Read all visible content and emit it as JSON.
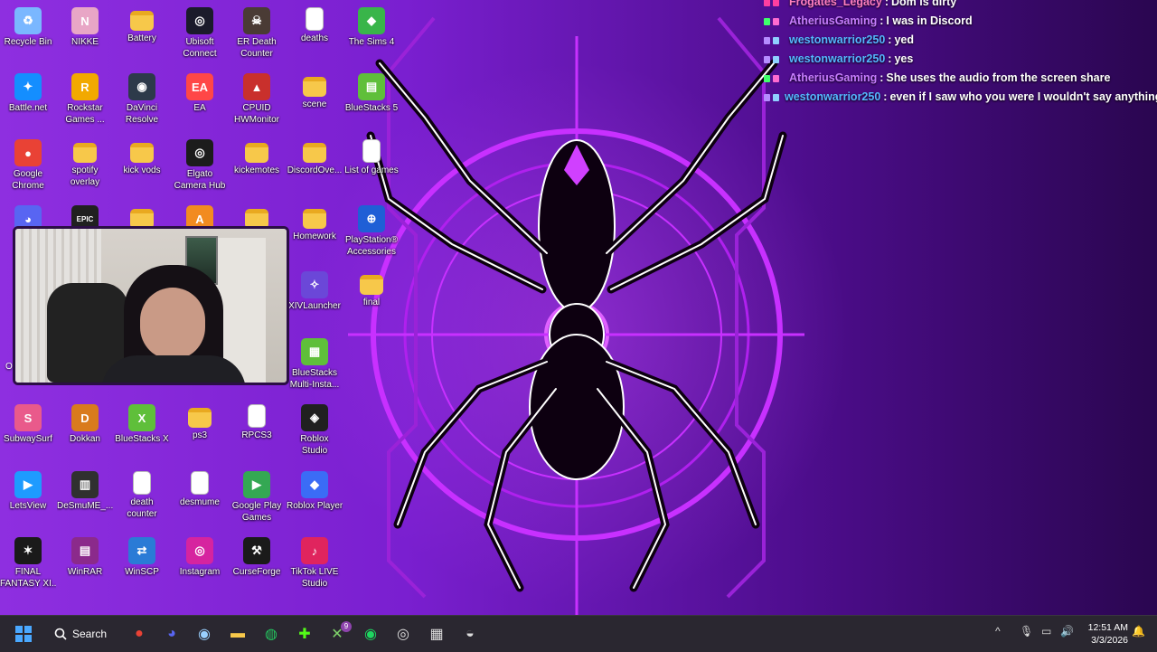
{
  "desktop": {
    "icons": [
      {
        "label": "Recycle Bin",
        "label2": "",
        "icon": "recycle-bin-icon",
        "glyph": "♻",
        "color": "#7ab7ff",
        "type": "app"
      },
      {
        "label": "NIKKE",
        "label2": "",
        "icon": "nikke-icon",
        "glyph": "N",
        "color": "#e8a6c6",
        "type": "app"
      },
      {
        "label": "Battery",
        "label2": "",
        "icon": "folder-icon",
        "glyph": "",
        "color": "#f7c84a",
        "type": "folder"
      },
      {
        "label": "Ubisoft",
        "label2": "Connect",
        "icon": "ubisoft-icon",
        "glyph": "◎",
        "color": "#1b1b2b",
        "type": "app"
      },
      {
        "label": "ER Death",
        "label2": "Counter",
        "icon": "er-death-counter-icon",
        "glyph": "☠",
        "color": "#4a3b35",
        "type": "app"
      },
      {
        "label": "deaths",
        "label2": "",
        "icon": "document-icon",
        "glyph": "",
        "color": "#ffffff",
        "type": "doc"
      },
      {
        "label": "The Sims 4",
        "label2": "",
        "icon": "sims-icon",
        "glyph": "◆",
        "color": "#39b54a",
        "type": "app"
      },
      {
        "label": "Battle.net",
        "label2": "",
        "icon": "battlenet-icon",
        "glyph": "✦",
        "color": "#148eff",
        "type": "app"
      },
      {
        "label": "Rockstar",
        "label2": "Games ...",
        "icon": "rockstar-icon",
        "glyph": "R",
        "color": "#f2a900",
        "type": "app"
      },
      {
        "label": "DaVinci",
        "label2": "Resolve",
        "icon": "davinci-icon",
        "glyph": "◉",
        "color": "#2d3a4a",
        "type": "app"
      },
      {
        "label": "EA",
        "label2": "",
        "icon": "ea-icon",
        "glyph": "EA",
        "color": "#ff4747",
        "type": "app"
      },
      {
        "label": "CPUID",
        "label2": "HWMonitor",
        "icon": "cpuid-icon",
        "glyph": "▲",
        "color": "#c9302c",
        "type": "app"
      },
      {
        "label": "scene",
        "label2": "",
        "icon": "folder-icon",
        "glyph": "",
        "color": "#f7c84a",
        "type": "folder"
      },
      {
        "label": "BlueStacks 5",
        "label2": "",
        "icon": "bluestacks-icon",
        "glyph": "▤",
        "color": "#5fbf3a",
        "type": "app"
      },
      {
        "label": "Google",
        "label2": "Chrome",
        "icon": "chrome-icon",
        "glyph": "●",
        "color": "#e94235",
        "type": "app"
      },
      {
        "label": "spotify",
        "label2": "overlay",
        "icon": "folder-icon",
        "glyph": "",
        "color": "#f7c84a",
        "type": "folder"
      },
      {
        "label": "kick vods",
        "label2": "",
        "icon": "folder-icon",
        "glyph": "",
        "color": "#f7c84a",
        "type": "folder"
      },
      {
        "label": "Elgato",
        "label2": "Camera Hub",
        "icon": "elgato-icon",
        "glyph": "◎",
        "color": "#1c1c1c",
        "type": "app"
      },
      {
        "label": "kickemotes",
        "label2": "",
        "icon": "folder-icon",
        "glyph": "",
        "color": "#f7c84a",
        "type": "folder"
      },
      {
        "label": "DiscordOve...",
        "label2": "",
        "icon": "folder-icon",
        "glyph": "",
        "color": "#f7c84a",
        "type": "folder"
      },
      {
        "label": "List of games",
        "label2": "",
        "icon": "document-icon",
        "glyph": "",
        "color": "#ffffff",
        "type": "doc"
      },
      {
        "label": "",
        "label2": "",
        "icon": "discord-icon",
        "glyph": "◕",
        "color": "#5865f2",
        "type": "app"
      },
      {
        "label": "",
        "label2": "",
        "icon": "epic-games-icon",
        "glyph": "EPIC",
        "color": "#202020",
        "type": "app"
      },
      {
        "label": "",
        "label2": "",
        "icon": "folder-icon",
        "glyph": "",
        "color": "#f7c84a",
        "type": "folder"
      },
      {
        "label": "",
        "label2": "",
        "icon": "app-icon",
        "glyph": "A",
        "color": "#f28b20",
        "type": "app"
      },
      {
        "label": "",
        "label2": "",
        "icon": "folder-icon",
        "glyph": "",
        "color": "#f7c84a",
        "type": "folder"
      },
      {
        "label": "Homework",
        "label2": "",
        "icon": "folder-icon",
        "glyph": "",
        "color": "#f7c84a",
        "type": "folder"
      },
      {
        "label": "PlayStation®",
        "label2": "Accessories",
        "icon": "playstation-icon",
        "glyph": "⊕",
        "color": "#1f5fd6",
        "type": "app"
      },
      {
        "label": "XIVLauncher",
        "label2": "",
        "icon": "xivlauncher-icon",
        "glyph": "✧",
        "color": "#6b47d8",
        "type": "app"
      },
      {
        "label": "final",
        "label2": "",
        "icon": "folder-icon",
        "glyph": "",
        "color": "#f7c84a",
        "type": "folder"
      },
      {
        "label": "BlueStacks",
        "label2": "Multi-Insta...",
        "icon": "bluestacks-multi-icon",
        "glyph": "▦",
        "color": "#5fbf3a",
        "type": "app"
      },
      {
        "label": "SubwaySurf",
        "label2": "",
        "icon": "subway-surf-icon",
        "glyph": "S",
        "color": "#e95a8b",
        "type": "app"
      },
      {
        "label": "Dokkan",
        "label2": "",
        "icon": "dokkan-icon",
        "glyph": "D",
        "color": "#d97b1d",
        "type": "app"
      },
      {
        "label": "BlueStacks X",
        "label2": "",
        "icon": "bluestacks-x-icon",
        "glyph": "X",
        "color": "#5fbf3a",
        "type": "app"
      },
      {
        "label": "ps3",
        "label2": "",
        "icon": "folder-icon",
        "glyph": "",
        "color": "#f7c84a",
        "type": "folder"
      },
      {
        "label": "RPCS3",
        "label2": "",
        "icon": "document-icon",
        "glyph": "",
        "color": "#ffffff",
        "type": "doc"
      },
      {
        "label": "Roblox",
        "label2": "Studio",
        "icon": "roblox-studio-icon",
        "glyph": "◈",
        "color": "#202020",
        "type": "app"
      },
      {
        "label": "LetsView",
        "label2": "",
        "icon": "letsview-icon",
        "glyph": "▶",
        "color": "#1e9bff",
        "type": "app"
      },
      {
        "label": "DeSmuME_...",
        "label2": "",
        "icon": "desmume-icon",
        "glyph": "▥",
        "color": "#303030",
        "type": "app"
      },
      {
        "label": "death",
        "label2": "counter",
        "icon": "document-icon",
        "glyph": "",
        "color": "#ffffff",
        "type": "doc"
      },
      {
        "label": "desmume",
        "label2": "",
        "icon": "document-icon",
        "glyph": "",
        "color": "#ffffff",
        "type": "doc"
      },
      {
        "label": "Google Play",
        "label2": "Games",
        "icon": "google-play-games-icon",
        "glyph": "▶",
        "color": "#34a853",
        "type": "app"
      },
      {
        "label": "Roblox Player",
        "label2": "",
        "icon": "roblox-player-icon",
        "glyph": "◆",
        "color": "#3b6cf6",
        "type": "app"
      },
      {
        "label": "FINAL",
        "label2": "FANTASY XI...",
        "icon": "final-fantasy-icon",
        "glyph": "✶",
        "color": "#1a1a1a",
        "type": "app"
      },
      {
        "label": "WinRAR",
        "label2": "",
        "icon": "winrar-icon",
        "glyph": "▤",
        "color": "#8b2a8b",
        "type": "app"
      },
      {
        "label": "WinSCP",
        "label2": "",
        "icon": "winscp-icon",
        "glyph": "⇄",
        "color": "#2a7bd6",
        "type": "app"
      },
      {
        "label": "Instagram",
        "label2": "",
        "icon": "instagram-icon",
        "glyph": "◎",
        "color": "#d6249f",
        "type": "app"
      },
      {
        "label": "CurseForge",
        "label2": "",
        "icon": "curseforge-icon",
        "glyph": "⚒",
        "color": "#1a1a1a",
        "type": "app"
      },
      {
        "label": "TikTok LIVE",
        "label2": "Studio",
        "icon": "tiktok-live-icon",
        "glyph": "♪",
        "color": "#e0245e",
        "type": "app"
      }
    ],
    "webcam_partial_label": "O"
  },
  "chat": {
    "messages": [
      {
        "user": "Frogates_Legacy",
        "text": "Dom is dirty",
        "user_color": "#ff7fbf",
        "badges": [
          "#ff3fa0",
          "#ff3fa0"
        ]
      },
      {
        "user": "AtheriusGaming",
        "text": "I was in Discord",
        "user_color": "#c77dff",
        "badges": [
          "#3fff6b",
          "#ff6bd0"
        ]
      },
      {
        "user": "westonwarrior250",
        "text": "yed",
        "user_color": "#55b7ff",
        "badges": [
          "#b58cff",
          "#8fd0ff"
        ]
      },
      {
        "user": "westonwarrior250",
        "text": "yes",
        "user_color": "#55b7ff",
        "badges": [
          "#b58cff",
          "#8fd0ff"
        ]
      },
      {
        "user": "AtheriusGaming",
        "text": "She uses the audio from the screen share",
        "user_color": "#c77dff",
        "badges": [
          "#3fff6b",
          "#ff6bd0"
        ]
      },
      {
        "user": "westonwarrior250",
        "text": "even if I saw who you were I wouldn't say anything",
        "user_color": "#55b7ff",
        "badges": [
          "#b58cff",
          "#8fd0ff"
        ]
      }
    ],
    "separator": ":"
  },
  "taskbar": {
    "search_label": "Search",
    "apps": [
      {
        "name": "start-icon",
        "glyph": "⊞",
        "color": "#4aa8ff"
      },
      {
        "name": "chrome-taskbar-icon",
        "glyph": "●",
        "color": "#e94235"
      },
      {
        "name": "discord-taskbar-icon",
        "glyph": "◕",
        "color": "#5865f2"
      },
      {
        "name": "steam-icon",
        "glyph": "◉",
        "color": "#9ad1ff"
      },
      {
        "name": "file-explorer-icon",
        "glyph": "▬",
        "color": "#f7c84a"
      },
      {
        "name": "xbox-icon",
        "glyph": "◍",
        "color": "#23c55e"
      },
      {
        "name": "kick-icon",
        "glyph": "✚",
        "color": "#53fc18"
      },
      {
        "name": "xbox-app-icon",
        "glyph": "✕",
        "color": "#7fd36b"
      },
      {
        "name": "spotify-icon",
        "glyph": "◉",
        "color": "#1ed760"
      },
      {
        "name": "camera-hub-icon",
        "glyph": "◎",
        "color": "#dddddd"
      },
      {
        "name": "keyboard-icon",
        "glyph": "▦",
        "color": "#dddddd"
      },
      {
        "name": "obs-icon",
        "glyph": "◒",
        "color": "#dddddd"
      }
    ],
    "badges": {
      "discord": "",
      "xbox": "9"
    },
    "tray": {
      "chevron": "^",
      "time": "12:51 AM",
      "date": "3/3/2026"
    }
  }
}
